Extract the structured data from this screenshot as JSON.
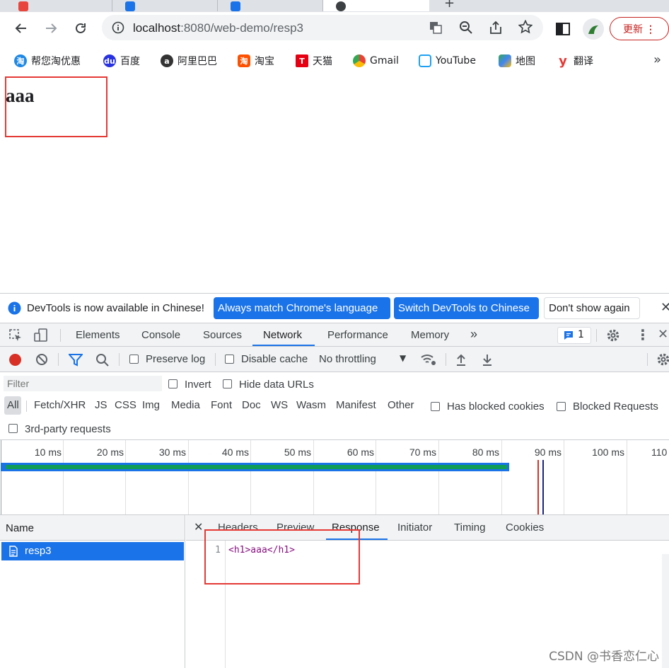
{
  "browser": {
    "url_host": "localhost",
    "url_path": ":8080/web-demo/resp3",
    "update_label": "更新",
    "bookmarks": [
      {
        "label": "帮您淘优惠",
        "icon": "taobao-deal-icon",
        "color": "#1e88e5"
      },
      {
        "label": "百度",
        "icon": "baidu-paw-icon",
        "color": "#2932e1"
      },
      {
        "label": "阿里巴巴",
        "icon": "alibaba-icon",
        "color": "#333333"
      },
      {
        "label": "淘宝",
        "icon": "taobao-icon",
        "color": "#ff5000"
      },
      {
        "label": "天猫",
        "icon": "tmall-icon",
        "color": "#e60012"
      },
      {
        "label": "Gmail",
        "icon": "chrome-icon",
        "color": "#34a853"
      },
      {
        "label": "YouTube",
        "icon": "tv-icon",
        "color": "#1da1f2"
      },
      {
        "label": "地图",
        "icon": "maps-icon",
        "color": "#34a853"
      },
      {
        "label": "翻译",
        "icon": "youdao-icon",
        "color": "#e53935"
      }
    ]
  },
  "page": {
    "heading": "aaa"
  },
  "devtools": {
    "infobar": {
      "message": "DevTools is now available in Chinese!",
      "btn_match": "Always match Chrome's language",
      "btn_switch": "Switch DevTools to Chinese",
      "btn_dismiss": "Don't show again"
    },
    "tabs": [
      "Elements",
      "Console",
      "Sources",
      "Network",
      "Performance",
      "Memory"
    ],
    "issues_count": "1",
    "toolbar": {
      "preserve_log": "Preserve log",
      "disable_cache": "Disable cache",
      "throttling": "No throttling"
    },
    "filter": {
      "placeholder": "Filter",
      "invert": "Invert",
      "hide_data_urls": "Hide data URLs",
      "types": [
        "All",
        "Fetch/XHR",
        "JS",
        "CSS",
        "Img",
        "Media",
        "Font",
        "Doc",
        "WS",
        "Wasm",
        "Manifest",
        "Other"
      ],
      "has_blocked_cookies": "Has blocked cookies",
      "blocked_requests": "Blocked Requests",
      "third_party": "3rd-party requests"
    },
    "timeline": {
      "ticks": [
        "10 ms",
        "20 ms",
        "30 ms",
        "40 ms",
        "50 ms",
        "60 ms",
        "70 ms",
        "80 ms",
        "90 ms",
        "100 ms",
        "110"
      ]
    },
    "requests": {
      "name_header": "Name",
      "rows": [
        {
          "name": "resp3"
        }
      ]
    },
    "detail_tabs": [
      "Headers",
      "Preview",
      "Response",
      "Initiator",
      "Timing",
      "Cookies"
    ],
    "response": {
      "line_number": "1",
      "code": "<h1>aaa</h1>"
    }
  },
  "watermark": "CSDN @书香恋仁心",
  "colors": {
    "accent": "#1a73e8",
    "highlight_box": "#e53935",
    "record": "#d93025"
  }
}
